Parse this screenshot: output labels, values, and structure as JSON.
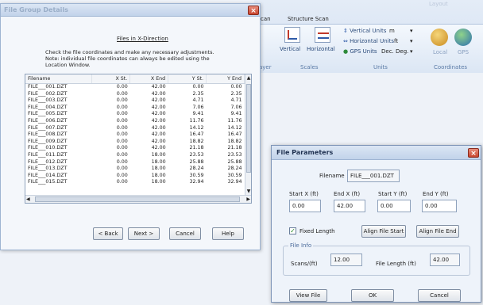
{
  "ribbon": {
    "tabs": [
      "can",
      "Structure Scan"
    ],
    "top_label": "Layout",
    "buttons": [
      "Vertical",
      "Horizontal"
    ],
    "group_scales": "Scales",
    "group_layer": "ayer",
    "units": [
      {
        "label": "Vertical Units",
        "value": "m"
      },
      {
        "label": "Horizontal Units",
        "value": "ft"
      },
      {
        "label": "GPS Units",
        "value": "Dec. Deg."
      }
    ],
    "group_units": "Units",
    "coord_buttons": [
      "Local",
      "GPS"
    ],
    "group_coordinates": "Coordinates"
  },
  "fgd": {
    "title": "File Group Details",
    "heading": "Files in X-Direction",
    "instructions": "Check the file coordinates and make any necessary adjustments. Note: individual file coordinates can always be edited using the Location Window.",
    "columns": [
      "Filename",
      "X St.",
      "X End",
      "Y St.",
      "Y End"
    ],
    "rows": [
      [
        "FILE___001.DZT",
        "0.00",
        "42.00",
        "0.00",
        "0.00"
      ],
      [
        "FILE___002.DZT",
        "0.00",
        "42.00",
        "2.35",
        "2.35"
      ],
      [
        "FILE___003.DZT",
        "0.00",
        "42.00",
        "4.71",
        "4.71"
      ],
      [
        "FILE___004.DZT",
        "0.00",
        "42.00",
        "7.06",
        "7.06"
      ],
      [
        "FILE___005.DZT",
        "0.00",
        "42.00",
        "9.41",
        "9.41"
      ],
      [
        "FILE___006.DZT",
        "0.00",
        "42.00",
        "11.76",
        "11.76"
      ],
      [
        "FILE___007.DZT",
        "0.00",
        "42.00",
        "14.12",
        "14.12"
      ],
      [
        "FILE___008.DZT",
        "0.00",
        "42.00",
        "16.47",
        "16.47"
      ],
      [
        "FILE___009.DZT",
        "0.00",
        "42.00",
        "18.82",
        "18.82"
      ],
      [
        "FILE___010.DZT",
        "0.00",
        "42.00",
        "21.18",
        "21.18"
      ],
      [
        "FILE___011.DZT",
        "0.00",
        "18.00",
        "23.53",
        "23.53"
      ],
      [
        "FILE___012.DZT",
        "0.00",
        "18.00",
        "25.88",
        "25.88"
      ],
      [
        "FILE___013.DZT",
        "0.00",
        "18.00",
        "28.24",
        "28.24"
      ],
      [
        "FILE___014.DZT",
        "0.00",
        "18.00",
        "30.59",
        "30.59"
      ],
      [
        "FILE___015.DZT",
        "0.00",
        "18.00",
        "32.94",
        "32.94"
      ]
    ],
    "back": "< Back",
    "next": "Next >",
    "cancel": "Cancel",
    "help": "Help"
  },
  "fp": {
    "title": "File Parameters",
    "filename_label": "Filename",
    "filename_value": "FILE___001.DZT",
    "startx_label": "Start X (ft)",
    "startx_value": "0.00",
    "endx_label": "End X (ft)",
    "endx_value": "42.00",
    "starty_label": "Start Y (ft)",
    "starty_value": "0.00",
    "endy_label": "End Y (ft)",
    "endy_value": "0.00",
    "fixed_length": "Fixed Length",
    "align_start": "Align File Start",
    "align_end": "Align File End",
    "fileinfo_label": "File Info",
    "scans_label": "Scans/(ft)",
    "scans_value": "12.00",
    "filelength_label": "File Length (ft)",
    "filelength_value": "42.00",
    "view_file": "View File",
    "ok": "OK",
    "cancel": "Cancel"
  }
}
